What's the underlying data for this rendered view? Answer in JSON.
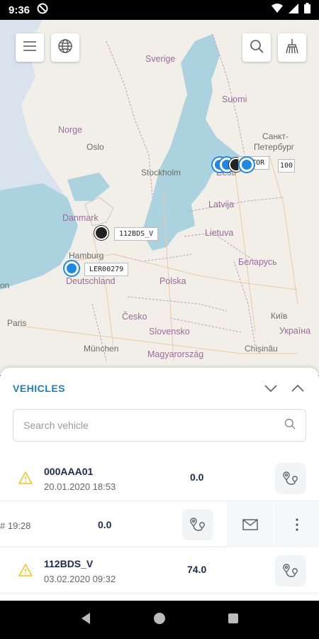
{
  "status_bar": {
    "time": "9:36"
  },
  "map": {
    "labels": {
      "sverige": "Sverige",
      "suomi": "Suomi",
      "norge": "Norge",
      "oslo": "Oslo",
      "stockholm": "Stockholm",
      "spb1": "Санкт-",
      "spb2": "Петербург",
      "eesti": "Eesti",
      "latvija": "Latvija",
      "lietuva": "Lietuva",
      "danmark": "Danmark",
      "hamburg": "Hamburg",
      "deutschland": "Deutschland",
      "polska": "Polska",
      "belarus": "Беларусь",
      "cesko": "Česko",
      "slovensko": "Slovensko",
      "paris": "Paris",
      "munchen": "München",
      "magyar": "Magyarország",
      "kyiv": "Київ",
      "ukraina": "Україна",
      "chisinau": "Chișinău",
      "on": "on"
    },
    "tags": {
      "t112": "112BDS_V",
      "tler": "LER00279",
      "taktor": "AKTOR",
      "t100": "100"
    }
  },
  "sheet": {
    "title": "VEHICLES",
    "search_placeholder": "Search vehicle",
    "rows": [
      {
        "name": "000AAA01",
        "date": "20.01.2020 18:53",
        "value": "0.0"
      },
      {
        "time_fragment": "# 19:28",
        "value": "0.0"
      },
      {
        "name": "112BDS_V",
        "date": "03.02.2020 09:32",
        "value": "74.0"
      }
    ]
  },
  "colors": {
    "accent": "#1a7fc9",
    "warning": "#f0c419",
    "text_dark": "#1d2a4d"
  }
}
